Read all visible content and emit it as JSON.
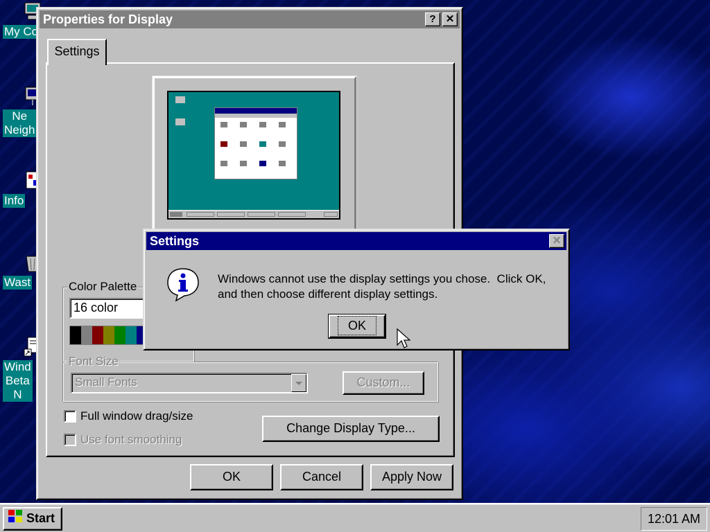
{
  "desktop": {
    "icons": [
      {
        "label": "My Co",
        "icon": "computer-icon"
      },
      {
        "label": "Ne\nNeigh",
        "icon": "network-neighborhood-icon"
      },
      {
        "label": "Info",
        "icon": "info-document-icon"
      },
      {
        "label": "Wast",
        "icon": "wastebasket-icon"
      },
      {
        "label": "Wind\nBeta\nN",
        "icon": "shortcut-document-icon"
      }
    ]
  },
  "properties_window": {
    "title": "Properties for Display",
    "help_button": "?",
    "close_button": "✕",
    "tab_label": "Settings",
    "color_palette": {
      "legend": "Color Palette",
      "value": "16 color",
      "swatches": [
        "#000000",
        "#808080",
        "#800000",
        "#808000",
        "#008000",
        "#008080",
        "#000080",
        "#800080"
      ]
    },
    "font_size": {
      "legend": "Font Size",
      "value": "Small Fonts",
      "custom_button": "Custom..."
    },
    "full_window_drag": "Full window drag/size",
    "font_smoothing": "Use font smoothing",
    "change_display_button": "Change Display Type...",
    "ok_button": "OK",
    "cancel_button": "Cancel",
    "apply_button": "Apply Now"
  },
  "alert_dialog": {
    "title": "Settings",
    "close_button": "✕",
    "icon": "information-icon",
    "message_line1": "Windows cannot use the display settings you chose.  Click OK,",
    "message_line2": "and then choose different display settings.",
    "ok_button": "OK"
  },
  "taskbar": {
    "start_label": "Start",
    "clock": "12:01 AM"
  },
  "colors": {
    "titlebar_active": "#000080",
    "titlebar_inactive": "#808080",
    "face": "#c0c0c0",
    "desktop_teal": "#008080"
  }
}
